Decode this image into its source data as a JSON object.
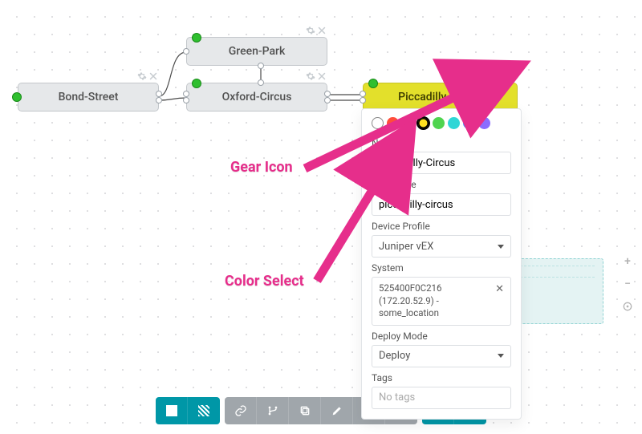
{
  "nodes": {
    "bond_street": "Bond-Street",
    "green_park": "Green-Park",
    "oxford_circus": "Oxford-Circus",
    "piccadilly_circus": "Piccadilly-Circus"
  },
  "panel": {
    "colors": [
      {
        "name": "none",
        "hex": "#ffffff",
        "selected": false,
        "empty": true
      },
      {
        "name": "red",
        "hex": "#ff4d3a",
        "selected": false
      },
      {
        "name": "orange",
        "hex": "#ff8a1f",
        "selected": false
      },
      {
        "name": "yellow",
        "hex": "#ffe11f",
        "selected": true
      },
      {
        "name": "green",
        "hex": "#4fd44f",
        "selected": false
      },
      {
        "name": "teal",
        "hex": "#2fd6d6",
        "selected": false
      },
      {
        "name": "blue",
        "hex": "#3a9bff",
        "selected": false
      },
      {
        "name": "purple",
        "hex": "#8b6cff",
        "selected": false
      }
    ],
    "fields": {
      "name_label": "Name",
      "name_value": "Piccadilly-Circus",
      "hostname_label": "Hostname",
      "hostname_value": "piccadilly-circus",
      "device_profile_label": "Device Profile",
      "device_profile_value": "Juniper vEX",
      "system_label": "System",
      "system_value": "525400F0C216 (172.20.52.9) - some_location",
      "deploy_mode_label": "Deploy Mode",
      "deploy_mode_value": "Deploy",
      "tags_label": "Tags",
      "tags_placeholder": "No tags"
    }
  },
  "callouts": {
    "gear": "Gear Icon",
    "color": "Color Select"
  },
  "zoom": {
    "plus": "+",
    "minus": "−"
  }
}
